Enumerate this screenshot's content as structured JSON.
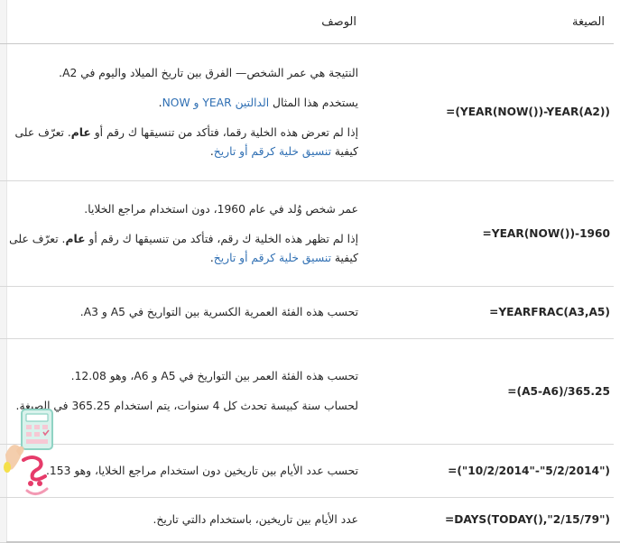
{
  "header": {
    "formula_col": "الصيغة",
    "desc_col": "الوصف"
  },
  "rows": [
    {
      "formula": "=(YEAR(NOW())-YEAR(A2))",
      "p1": "النتيجة هي عمر الشخص— الفرق بين تاريخ الميلاد واليوم في A2.",
      "p2_pre": "يستخدم هذا المثال ",
      "p2_link": "الدالتين YEAR و NOW",
      "p2_post": ".",
      "p3_pre": "إذا لم تعرض هذه الخلية رقما، فتأكد من تنسيقها ك رقم أو ",
      "p3_bold": "عام",
      "p3_mid": ". تعرّف على كيفية ",
      "p3_link": "تنسيق خلية كرقم أو تاريخ",
      "p3_post": "."
    },
    {
      "formula": "=YEAR(NOW())-1960",
      "p1": "عمر شخص وُلد في عام 1960، دون استخدام مراجع الخلايا.",
      "p2_pre": "إذا لم تظهر هذه الخلية ك رقم، فتأكد من تنسيقها ك رقم أو ",
      "p2_bold": "عام",
      "p2_mid": ". تعرّف على كيفية ",
      "p2_link": "تنسيق خلية كرقم أو تاريخ",
      "p2_post": "."
    },
    {
      "formula": "=YEARFRAC(A3,A5)",
      "p1": "تحسب هذه الفئة العمرية الكسرية بين التواريخ في A5 و A3."
    },
    {
      "formula": "=(A5-A6)/365.25",
      "p1": "تحسب هذه الفئة العمر بين التواريخ في A5 و A6، وهو 12.08.",
      "p2": "لحساب سنة كبيسة تحدث كل 4 سنوات، يتم استخدام 365.25 في الصيغة."
    },
    {
      "formula": "=(\"10/2/2014\"-\"5/2/2014\")",
      "p1": "تحسب عدد الأيام بين تاريخين دون استخدام مراجع الخلايا، وهو 153."
    },
    {
      "formula": "=DAYS(TODAY(),\"2/15/79\")",
      "p1": "عدد الأيام بين تاريخين، باستخدام دالتي تاريخ."
    }
  ],
  "colors": {
    "link": "#2f6fb3",
    "border": "#d8d8d8",
    "header_border": "#c8c8c8"
  },
  "watermark": {
    "icon": "calculator-hand-logo"
  }
}
